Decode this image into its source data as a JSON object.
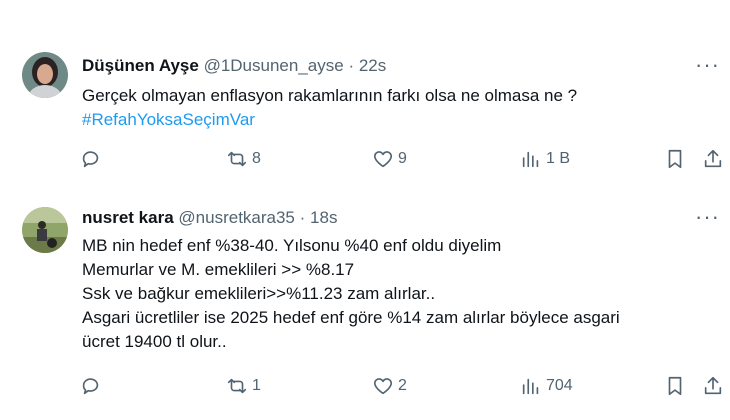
{
  "tweets": [
    {
      "name": "Düşünen Ayşe",
      "handle": "@1Dusunen_ayse",
      "separator": "·",
      "time": "22s",
      "more": "···",
      "lines": [
        "Gerçek olmayan enflasyon rakamlarının farkı olsa ne olmasa ne ?"
      ],
      "hashtag": "#RefahYoksaSeçimVar",
      "reply_count": "",
      "retweet_count": "8",
      "like_count": "9",
      "view_count": "1 B"
    },
    {
      "name": "nusret kara",
      "handle": "@nusretkara35",
      "separator": "·",
      "time": "18s",
      "more": "···",
      "lines": [
        "MB nin hedef enf %38-40. Yılsonu %40 enf oldu diyelim",
        "Memurlar ve M. emeklileri >> %8.17",
        "Ssk ve bağkur emeklileri>>%11.23 zam alırlar..",
        "Asgari ücretliler ise 2025 hedef enf göre %14 zam alırlar böylece asgari",
        "ücret 19400 tl olur.."
      ],
      "reply_count": "",
      "retweet_count": "1",
      "like_count": "2",
      "view_count": "704"
    }
  ],
  "icons": {
    "reply": "reply-icon",
    "retweet": "retweet-icon",
    "like": "heart-icon",
    "views": "views-icon",
    "bookmark": "bookmark-icon",
    "share": "share-icon"
  },
  "colors": {
    "text": "#0f1419",
    "secondary": "#536471",
    "link": "#1d9bf0",
    "divider": "#eff3f4"
  }
}
